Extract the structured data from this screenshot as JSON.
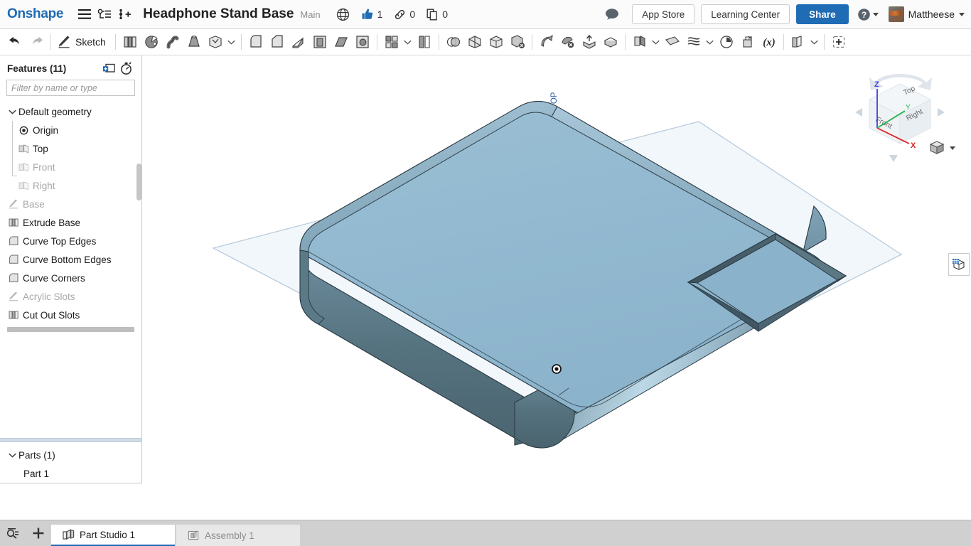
{
  "app": {
    "brand": "Onshape",
    "document_title": "Headphone Stand Base",
    "branch": "Main"
  },
  "topbar": {
    "menu_icon": "hamburger-menu-icon",
    "tree_icon": "document-tree-icon",
    "version_icon": "version-graph-icon",
    "public_icon": "globe-public-icon",
    "like_icon": "thumbs-up-icon",
    "like_count": "1",
    "link_icon": "link-icon",
    "link_count": "0",
    "copy_icon": "copy-icon",
    "copy_count": "0",
    "comment_icon": "comment-bubble-icon",
    "app_store_label": "App Store",
    "learning_center_label": "Learning Center",
    "share_label": "Share",
    "help_icon": "help-question-icon",
    "user_name": "Mattheese"
  },
  "toolbar": {
    "undo_label": "undo-icon",
    "redo_label": "redo-icon",
    "sketch_label": "Sketch",
    "items": [
      {
        "name": "extrude-tool",
        "label": "Extrude"
      },
      {
        "name": "revolve-tool",
        "label": "Revolve"
      },
      {
        "name": "sweep-tool",
        "label": "Sweep"
      },
      {
        "name": "loft-tool",
        "label": "Loft"
      },
      {
        "name": "thicken-tool",
        "label": "Thicken"
      },
      {
        "name": "fillet-tool",
        "label": "Fillet"
      },
      {
        "name": "chamfer-tool",
        "label": "Chamfer"
      },
      {
        "name": "rib-tool",
        "label": "Rib"
      },
      {
        "name": "shell-tool",
        "label": "Shell"
      },
      {
        "name": "draft-tool",
        "label": "Draft"
      },
      {
        "name": "hole-tool",
        "label": "Hole"
      },
      {
        "name": "pattern-tool",
        "label": "Linear pattern"
      },
      {
        "name": "mirror-tool",
        "label": "Mirror"
      },
      {
        "name": "boolean-tool",
        "label": "Boolean"
      },
      {
        "name": "split-tool",
        "label": "Split"
      },
      {
        "name": "transform-tool",
        "label": "Transform"
      },
      {
        "name": "delete-face-tool",
        "label": "Delete face"
      },
      {
        "name": "move-face-tool",
        "label": "Move face"
      },
      {
        "name": "replace-face-tool",
        "label": "Replace face"
      },
      {
        "name": "delete-part-tool",
        "label": "Delete part"
      },
      {
        "name": "import-tool",
        "label": "Import"
      },
      {
        "name": "derive-tool",
        "label": "Derive"
      },
      {
        "name": "plane-tool",
        "label": "Plane"
      },
      {
        "name": "curve-tool",
        "label": "Curve"
      },
      {
        "name": "surface-tool",
        "label": "Surface"
      },
      {
        "name": "sketch-history-tool",
        "label": "History"
      },
      {
        "name": "assembly-feature-tool",
        "label": "Assembly feature"
      },
      {
        "name": "variable-tool",
        "label": "Variable"
      },
      {
        "name": "multi-part-tool",
        "label": "Multi-part"
      },
      {
        "name": "custom-feature-tool",
        "label": "Add custom feature"
      }
    ]
  },
  "features_panel": {
    "title": "Features (11)",
    "add_folder_icon": "add-folder-icon",
    "rollback_icon": "rollback-timer-icon",
    "filter_placeholder": "Filter by name or type",
    "tree": [
      {
        "label": "Default geometry",
        "icon": "chevron-down-icon",
        "type": "folder",
        "dim": false
      },
      {
        "label": "Origin",
        "icon": "origin-icon",
        "type": "child",
        "dim": false
      },
      {
        "label": "Top",
        "icon": "plane-icon",
        "type": "child",
        "dim": false
      },
      {
        "label": "Front",
        "icon": "plane-icon",
        "type": "child",
        "dim": true
      },
      {
        "label": "Right",
        "icon": "plane-icon",
        "type": "child",
        "dim": true
      },
      {
        "label": "Base",
        "icon": "sketch-icon",
        "type": "feature",
        "dim": true
      },
      {
        "label": "Extrude Base",
        "icon": "extrude-icon",
        "type": "feature",
        "dim": false
      },
      {
        "label": "Curve Top Edges",
        "icon": "fillet-icon",
        "type": "feature",
        "dim": false
      },
      {
        "label": "Curve Bottom Edges",
        "icon": "fillet-icon",
        "type": "feature",
        "dim": false
      },
      {
        "label": "Curve Corners",
        "icon": "fillet-icon",
        "type": "feature",
        "dim": false
      },
      {
        "label": "Acrylic Slots",
        "icon": "sketch-icon",
        "type": "feature",
        "dim": true
      },
      {
        "label": "Cut Out Slots",
        "icon": "extrude-icon",
        "type": "feature",
        "dim": false
      }
    ]
  },
  "parts_panel": {
    "title": "Parts (1)",
    "items": [
      {
        "label": "Part 1"
      }
    ]
  },
  "graphics": {
    "plane_label": "TOP",
    "origin_marker": "origin-point-marker",
    "part_color": "#8fb6ce",
    "part_side_color": "#55707f",
    "plane_fill": "#f2f7fb",
    "plane_stroke": "#b8cadd",
    "edge_color": "#2b3b44"
  },
  "viewcube": {
    "face_top": "Top",
    "face_front": "Front",
    "face_right": "Right",
    "axis_x": "X",
    "axis_y": "Y",
    "axis_z": "Z",
    "axis_x_color": "#e02020",
    "axis_y_color": "#22b14c",
    "axis_z_color": "#4040e0",
    "display_icon": "display-style-cube-icon"
  },
  "right_dock": {
    "appearance_icon": "appearance-panel-icon"
  },
  "tabbar": {
    "search_icon": "tab-search-icon",
    "add_icon": "add-tab-icon",
    "tabs": [
      {
        "label": "Part Studio 1",
        "icon": "part-studio-icon",
        "active": true
      },
      {
        "label": "Assembly 1",
        "icon": "assembly-icon",
        "active": false
      }
    ]
  }
}
